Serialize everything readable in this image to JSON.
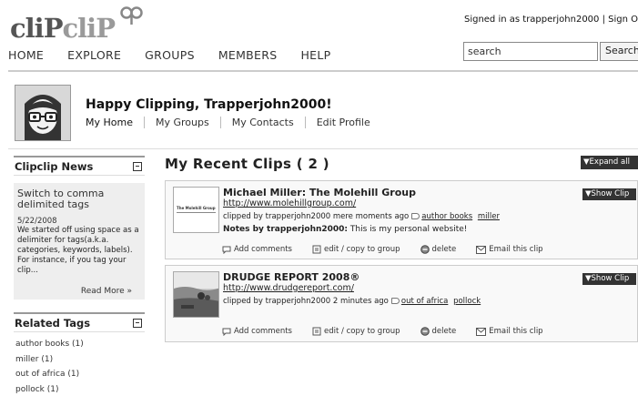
{
  "header": {
    "logo_part1": "cliP",
    "logo_part2": "cliP",
    "signed_in_text": "Signed in as trapperjohn2000 | Sign O",
    "nav": [
      "HOME",
      "EXPLORE",
      "GROUPS",
      "MEMBERS",
      "HELP"
    ],
    "search_value": "search",
    "search_button": "Search"
  },
  "profile": {
    "greeting": "Happy Clipping, Trapperjohn2000!",
    "subnav": [
      "My Home",
      "My Groups",
      "My Contacts",
      "Edit Profile"
    ]
  },
  "sidebar": {
    "news": {
      "title": "Clipclip News",
      "headline": "Switch to comma delimited tags",
      "date": "5/22/2008",
      "text": "We started off using space as a delimiter for tags(a.k.a. categories, keywords, labels). For instance, if you tag your clip...",
      "read_more": "Read More »"
    },
    "related_tags": {
      "title": "Related Tags",
      "items": [
        "author books (1)",
        "miller (1)",
        "out of africa (1)",
        "pollock (1)"
      ]
    }
  },
  "main": {
    "title": "My Recent Clips ( 2 )",
    "expand_all": "▼Expand all",
    "clips": [
      {
        "title": "Michael Miller: The Molehill Group",
        "url": "http://www.molehillgroup.com/",
        "meta": "clipped by trapperjohn2000 mere moments ago",
        "tags": [
          "author books",
          "miller"
        ],
        "notes_label": "Notes by trapperjohn2000:",
        "notes": "This is my personal website!",
        "show_clip": "▼Show Clip",
        "thumb_text": "The Molehill Group"
      },
      {
        "title": "DRUDGE REPORT 2008®",
        "url": "http://www.drudgereport.com/",
        "meta": "clipped by trapperjohn2000 2 minutes ago",
        "tags": [
          "out of africa",
          "pollock"
        ],
        "show_clip": "▼Show Clip"
      }
    ],
    "actions": {
      "add_comments": "Add comments",
      "edit_copy": "edit / copy to group",
      "delete": "delete",
      "email": "Email this clip"
    }
  }
}
